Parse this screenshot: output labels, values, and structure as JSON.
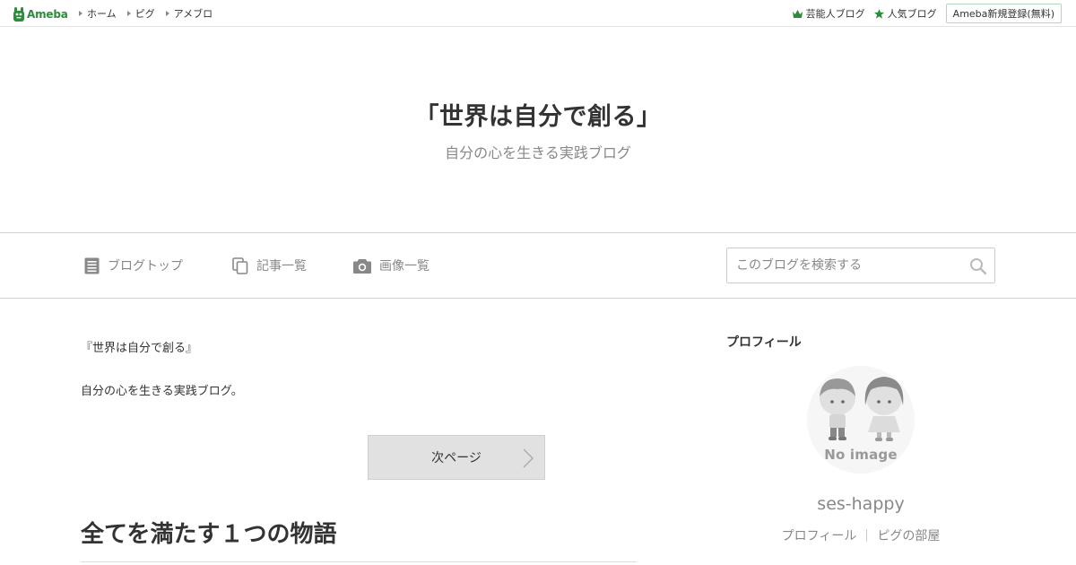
{
  "topbar": {
    "logo_text": "Ameba",
    "nav": [
      {
        "label": "ホーム"
      },
      {
        "label": "ピグ"
      },
      {
        "label": "アメブロ"
      }
    ],
    "right": {
      "celeb_blog": "芸能人ブログ",
      "popular_blog": "人気ブログ",
      "register": "Ameba新規登録(無料)"
    }
  },
  "header": {
    "title": "「世界は自分で創る」",
    "description": "自分の心を生きる実践ブログ"
  },
  "blognav": {
    "items": [
      {
        "label": "ブログトップ",
        "icon": "document-icon"
      },
      {
        "label": "記事一覧",
        "icon": "copy-pages-icon"
      },
      {
        "label": "画像一覧",
        "icon": "camera-icon"
      }
    ],
    "search_placeholder": "このブログを検索する"
  },
  "main": {
    "intro_line1": "『世界は自分で創る』",
    "intro_line2": "自分の心を生きる実践ブログ。",
    "next_page": "次ページ",
    "entry_title": "全てを満たす１つの物語"
  },
  "sidebar": {
    "heading": "プロフィール",
    "avatar_text": "No image",
    "username": "ses-happy",
    "links": [
      {
        "label": "プロフィール"
      },
      {
        "label": "ピグの部屋"
      }
    ]
  },
  "colors": {
    "brand_green": "#2d8c3c",
    "muted_text": "#888888",
    "button_bg": "#e1e1e1"
  }
}
